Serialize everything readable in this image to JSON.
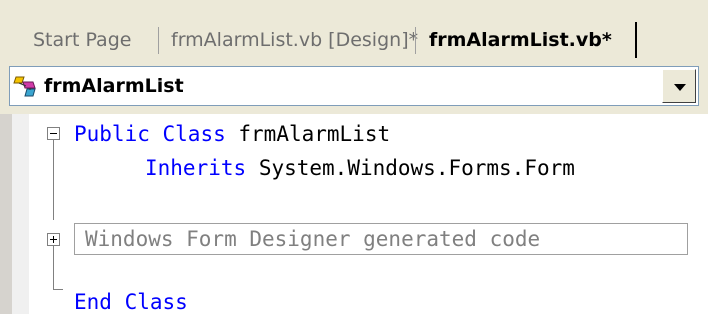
{
  "tabs": [
    {
      "label": "Start Page",
      "active": false
    },
    {
      "label": "frmAlarmList.vb [Design]*",
      "active": false
    },
    {
      "label": "frmAlarmList.vb*",
      "active": true
    }
  ],
  "class_dropdown": {
    "icon": "class-icon",
    "value": "frmAlarmList"
  },
  "code": {
    "line1": {
      "kw_public": "Public",
      "kw_class": "Class",
      "name": "frmAlarmList"
    },
    "line2": {
      "kw_inherits": "Inherits",
      "type": "System.Windows.Forms.Form"
    },
    "region": {
      "label": "Windows Form Designer generated code",
      "collapsed": true
    },
    "line_end": {
      "kw_end": "End",
      "kw_class": "Class"
    }
  },
  "colors": {
    "keyword": "#0000ff",
    "chrome": "#ece9d8",
    "region_text": "#808080"
  }
}
